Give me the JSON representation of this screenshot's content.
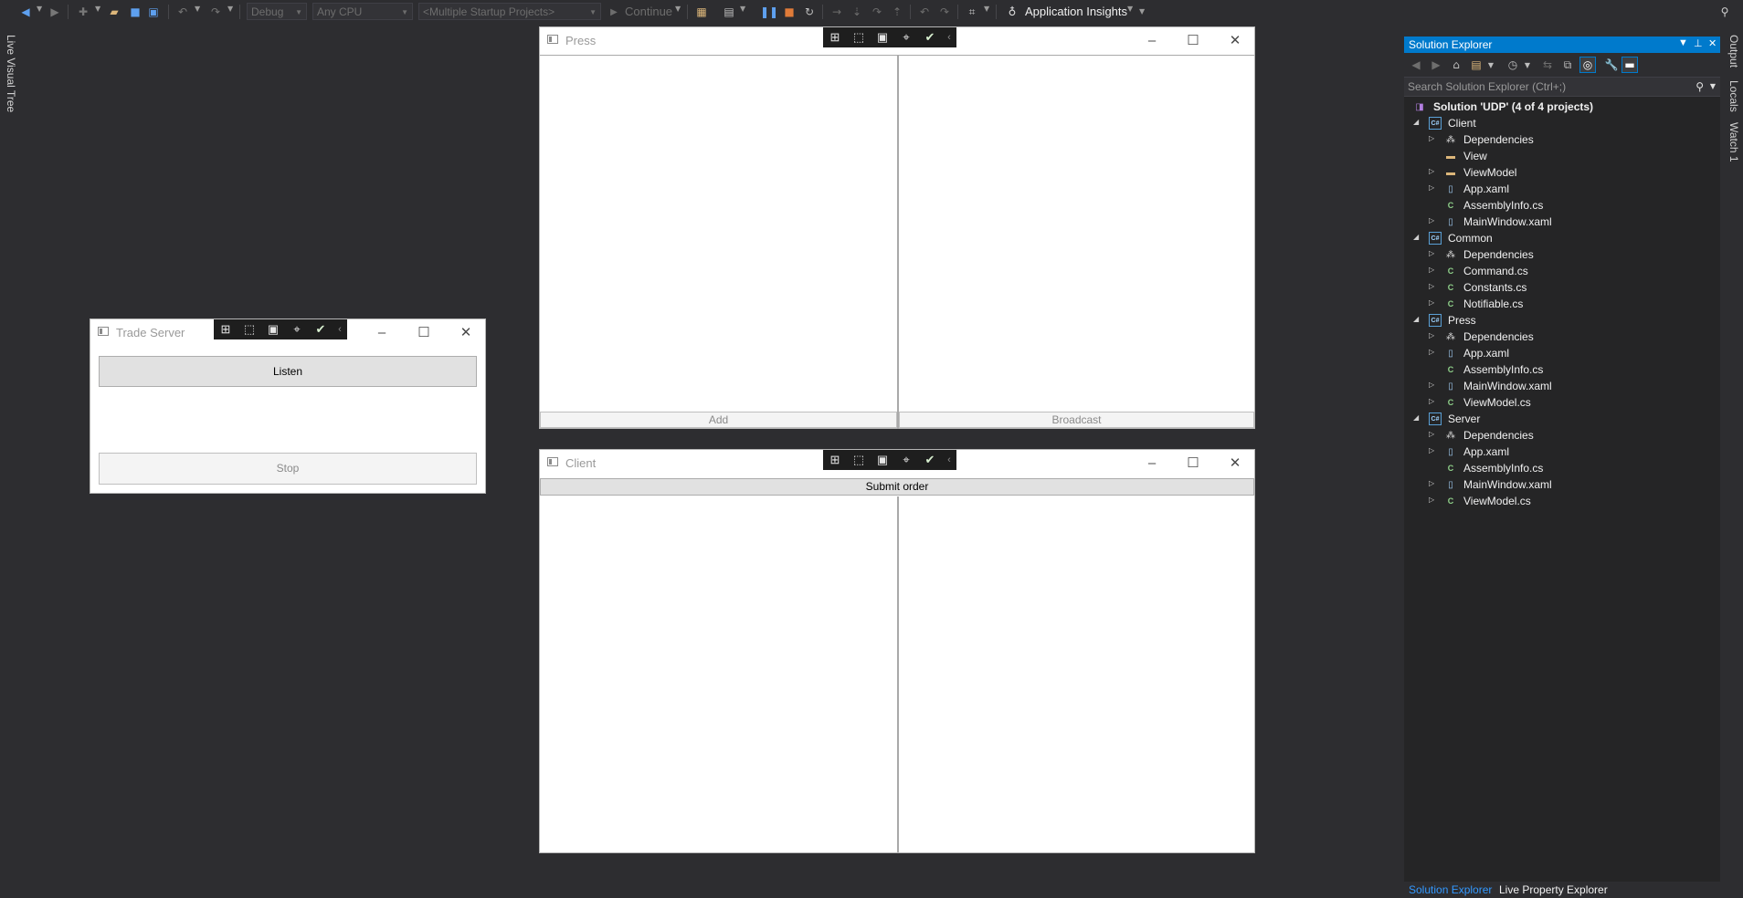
{
  "toolbar": {
    "config": "Debug",
    "platform": "Any CPU",
    "startup": "<Multiple Startup Projects>",
    "continue_label": "Continue",
    "insights_label": "Application Insights"
  },
  "side_tabs": {
    "left": "Live Visual Tree",
    "right": [
      "Output",
      "Locals",
      "Watch 1"
    ]
  },
  "windows": {
    "trade_server": {
      "title": "Trade Server",
      "listen": "Listen",
      "stop": "Stop"
    },
    "press": {
      "title": "Press",
      "add": "Add",
      "broadcast": "Broadcast"
    },
    "client": {
      "title": "Client",
      "submit": "Submit order"
    }
  },
  "solution_explorer": {
    "title": "Solution Explorer",
    "search_placeholder": "Search Solution Explorer (Ctrl+;)",
    "solution": "Solution 'UDP' (4 of 4 projects)",
    "projects": {
      "client": {
        "name": "Client",
        "items": [
          "Dependencies",
          "View",
          "ViewModel",
          "App.xaml",
          "AssemblyInfo.cs",
          "MainWindow.xaml"
        ]
      },
      "common": {
        "name": "Common",
        "items": [
          "Dependencies",
          "Command.cs",
          "Constants.cs",
          "Notifiable.cs"
        ]
      },
      "press": {
        "name": "Press",
        "items": [
          "Dependencies",
          "App.xaml",
          "AssemblyInfo.cs",
          "MainWindow.xaml",
          "ViewModel.cs"
        ]
      },
      "server": {
        "name": "Server",
        "items": [
          "Dependencies",
          "App.xaml",
          "AssemblyInfo.cs",
          "MainWindow.xaml",
          "ViewModel.cs"
        ]
      }
    },
    "bottom_tabs": [
      "Solution Explorer",
      "Live Property Explorer"
    ]
  },
  "colors": {
    "ide_background": "#2d2d30",
    "accent": "#007acc",
    "window_background": "#ffffff"
  }
}
